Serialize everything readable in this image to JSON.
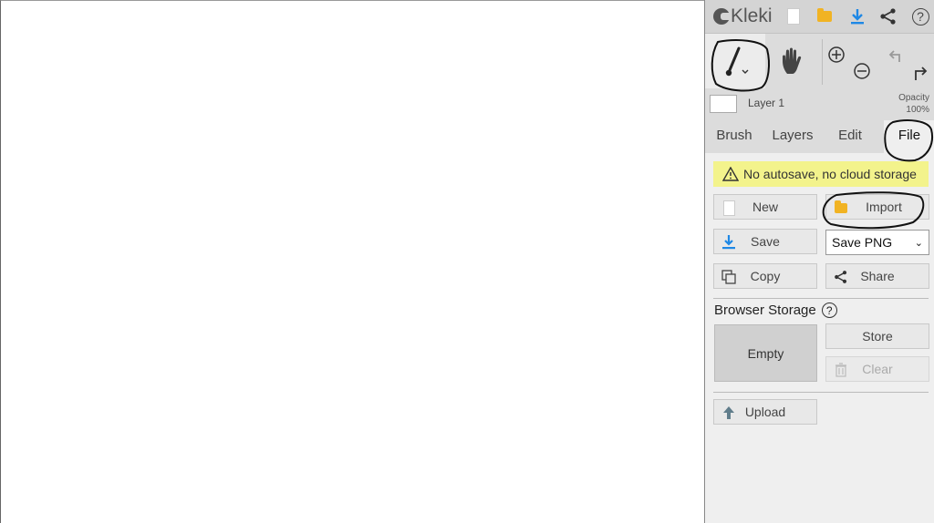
{
  "app": {
    "name": "Kleki"
  },
  "topbar": {
    "new": "new-icon",
    "import": "folder-icon",
    "save": "download-icon",
    "share": "share-icon",
    "help": "?"
  },
  "layer": {
    "name": "Layer 1",
    "opacity_label": "Opacity",
    "opacity_value": "100%"
  },
  "tabs": [
    "Brush",
    "Layers",
    "Edit",
    "File"
  ],
  "file_panel": {
    "warning": "No autosave, no cloud storage",
    "new_label": "New",
    "import_label": "Import",
    "save_label": "Save",
    "save_format": "Save PNG",
    "copy_label": "Copy",
    "share_label": "Share",
    "storage_title": "Browser Storage",
    "storage_help": "?",
    "storage_state": "Empty",
    "store_label": "Store",
    "clear_label": "Clear",
    "upload_label": "Upload"
  },
  "colors": {
    "accent_blue": "#1e88e5",
    "folder_yellow": "#f1b323",
    "warning_bg": "#f3f38c"
  }
}
